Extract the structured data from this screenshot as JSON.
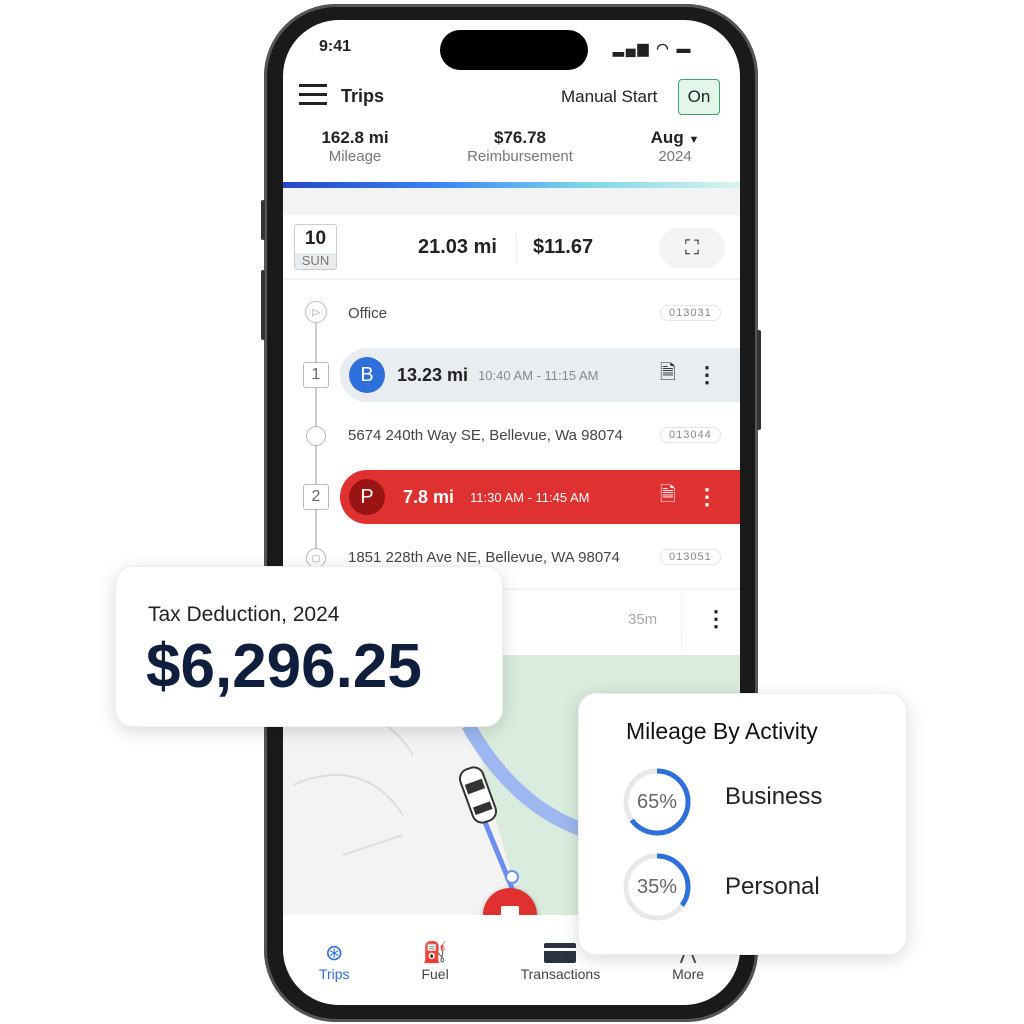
{
  "status": {
    "time": "9:41"
  },
  "header": {
    "title": "Trips",
    "manual_start_label": "Manual Start",
    "toggle": "On"
  },
  "stats": {
    "mileage_value": "162.8 mi",
    "mileage_label": "Mileage",
    "reimb_value": "$76.78",
    "reimb_label": "Reimbursement",
    "month": "Aug",
    "year": "2024"
  },
  "day": {
    "date": "10",
    "weekday": "SUN",
    "miles": "21.03 mi",
    "amount": "$11.67"
  },
  "timeline": {
    "start": {
      "label": "Office",
      "code": "013031"
    },
    "trips": [
      {
        "index": "1",
        "type": "B",
        "miles": "13.23 mi",
        "time": "10:40 AM - 11:15 AM",
        "color": "#2f6fdc"
      },
      {
        "index": "2",
        "type": "P",
        "miles": "7.8 mi",
        "time": "11:30 AM - 11:45 AM",
        "color": "#e03131"
      }
    ],
    "stops": [
      {
        "label": "5674 240th Way SE, Bellevue, Wa 98074",
        "code": "013044"
      },
      {
        "label": "1851 228th Ave NE, Bellevue, WA 98074",
        "code": "013051"
      }
    ],
    "next_duration": "35m"
  },
  "nav": [
    {
      "label": "Trips",
      "icon": "steering-wheel-icon",
      "active": true
    },
    {
      "label": "Fuel",
      "icon": "fuel-pump-icon"
    },
    {
      "label": "Transactions",
      "icon": "credit-card-icon"
    },
    {
      "label": "More",
      "icon": "more-icon"
    }
  ],
  "tax_card": {
    "label": "Tax Deduction, 2024",
    "amount": "$6,296.25"
  },
  "activity_card": {
    "title": "Mileage By Activity",
    "items": [
      {
        "percent_label": "65%",
        "value": 65,
        "label": "Business"
      },
      {
        "percent_label": "35%",
        "value": 35,
        "label": "Personal"
      }
    ],
    "accent": "#2f6fdc"
  }
}
